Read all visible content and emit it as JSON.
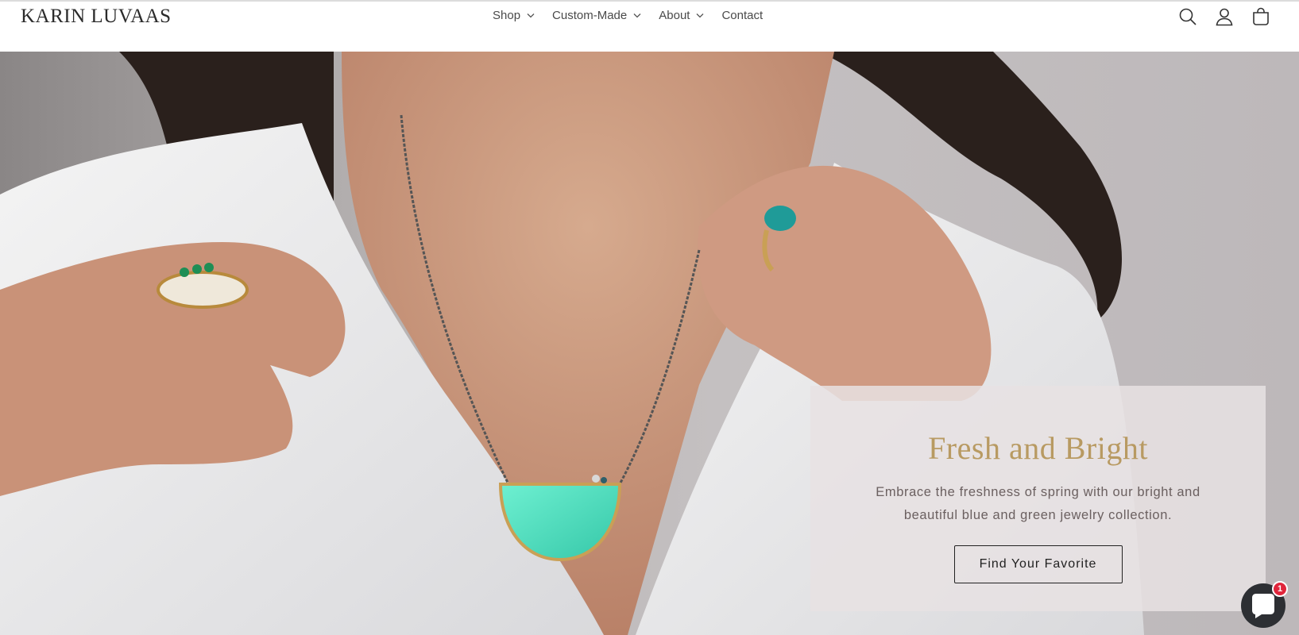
{
  "header": {
    "logo": "KARIN LUVAAS",
    "nav": [
      {
        "label": "Shop",
        "has_dropdown": true
      },
      {
        "label": "Custom-Made",
        "has_dropdown": true
      },
      {
        "label": "About",
        "has_dropdown": true
      },
      {
        "label": "Contact",
        "has_dropdown": false
      }
    ],
    "icons": [
      "search-icon",
      "account-icon",
      "cart-icon"
    ]
  },
  "hero": {
    "title": "Fresh and Bright",
    "text": "Embrace the freshness of spring with our bright and beautiful blue and green jewelry collection.",
    "button": "Find Your Favorite"
  },
  "chat": {
    "icon": "chat-bubble-icon",
    "badge": "1"
  },
  "colors": {
    "accent_gold": "#b89a62",
    "turquoise": "#3fd6b8",
    "chat_bg": "#2d2f33",
    "badge_red": "#e0253b"
  }
}
